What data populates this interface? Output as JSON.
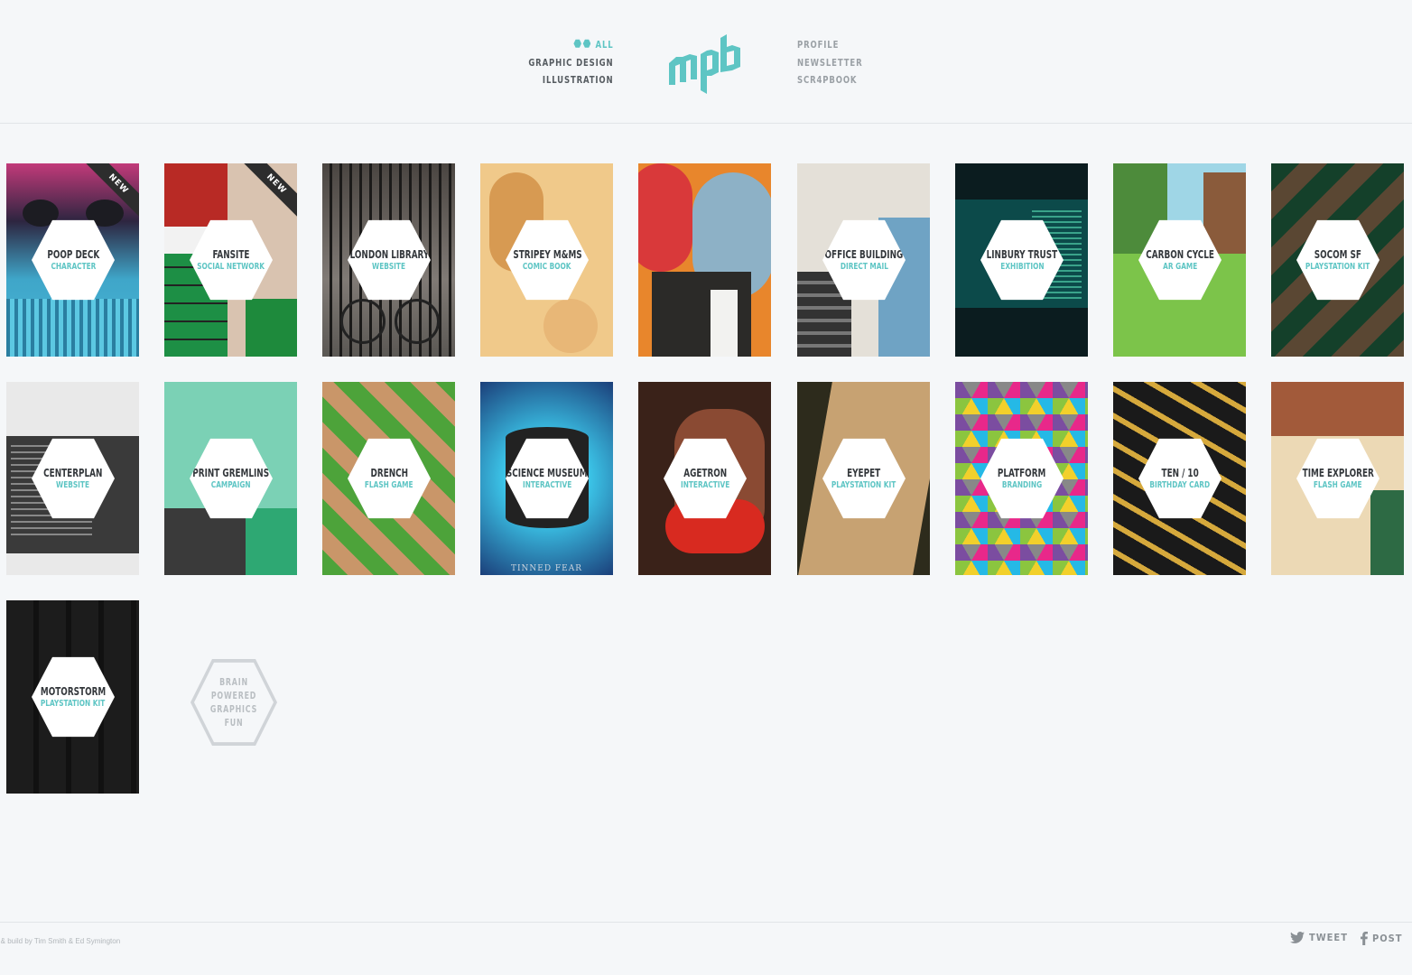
{
  "nav": {
    "left": [
      {
        "label": "ALL",
        "active": true
      },
      {
        "label": "GRAPHIC DESIGN",
        "active": false
      },
      {
        "label": "ILLUSTRATION",
        "active": false
      }
    ],
    "right": [
      {
        "label": "PROFILE"
      },
      {
        "label": "NEWSLETTER"
      },
      {
        "label": "SCR4PBOOK"
      }
    ],
    "logo_text": "mpb"
  },
  "colors": {
    "accent": "#5ec5c4",
    "background": "#f5f7f9",
    "title": "#34383c"
  },
  "projects": [
    {
      "title": "POOP DECK",
      "subtitle": "CHARACTER",
      "new": true,
      "art": "poop-deck"
    },
    {
      "title": "FANSITE",
      "subtitle": "SOCIAL NETWORK",
      "new": true,
      "art": "fansite"
    },
    {
      "title": "LONDON LIBRARY",
      "subtitle": "WEBSITE",
      "new": false,
      "art": "london-library"
    },
    {
      "title": "STRIPEY M&MS",
      "subtitle": "COMIC BOOK",
      "new": false,
      "art": "stripey"
    },
    {
      "title": "",
      "subtitle": "",
      "new": false,
      "art": "creatures"
    },
    {
      "title": "OFFICE BUILDING",
      "subtitle": "DIRECT MAIL",
      "new": false,
      "art": "office"
    },
    {
      "title": "LINBURY TRUST",
      "subtitle": "EXHIBITION",
      "new": false,
      "art": "linbury"
    },
    {
      "title": "CARBON CYCLE",
      "subtitle": "AR GAME",
      "new": false,
      "art": "carbon"
    },
    {
      "title": "SOCOM SF",
      "subtitle": "PLAYSTATION KIT",
      "new": false,
      "art": "socom"
    },
    {
      "title": "CENTERPLAN",
      "subtitle": "WEBSITE",
      "new": false,
      "art": "centerplan"
    },
    {
      "title": "PRINT GREMLINS",
      "subtitle": "CAMPAIGN",
      "new": false,
      "art": "gremlins"
    },
    {
      "title": "DRENCH",
      "subtitle": "FLASH GAME",
      "new": false,
      "art": "drench"
    },
    {
      "title": "SCIENCE MUSEUM",
      "subtitle": "INTERACTIVE",
      "new": false,
      "art": "science"
    },
    {
      "title": "AGETRON",
      "subtitle": "INTERACTIVE",
      "new": false,
      "art": "agetron"
    },
    {
      "title": "EYEPET",
      "subtitle": "PLAYSTATION KIT",
      "new": false,
      "art": "eyepet"
    },
    {
      "title": "PLATFORM",
      "subtitle": "BRANDING",
      "new": false,
      "art": "platform"
    },
    {
      "title": "TEN / 10",
      "subtitle": "BIRTHDAY CARD",
      "new": false,
      "art": "ten"
    },
    {
      "title": "TIME EXPLORER",
      "subtitle": "FLASH GAME",
      "new": false,
      "art": "time"
    },
    {
      "title": "MOTORSTORM",
      "subtitle": "PLAYSTATION KIT",
      "new": false,
      "art": "motorstorm"
    }
  ],
  "new_label": "NEW",
  "science_caption": "TINNED FEAR",
  "promo": {
    "text": "BRAIN POWERED GRAPHICS FUN"
  },
  "footer": {
    "credit": "n & build by Tim Smith & Ed Symington",
    "tweet": "TWEET",
    "post": "POST"
  }
}
